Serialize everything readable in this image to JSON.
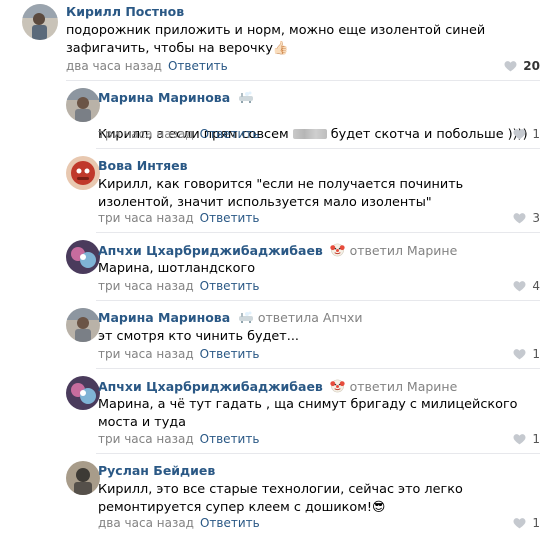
{
  "comments": [
    {
      "author": "Кирилл Постнов",
      "reply_to": "",
      "text": "подорожник приложить и норм, можно еще изолентой синей зафигачить, чтобы на верочку👍🏻",
      "time": "два часа назад",
      "reply_label": "Ответить",
      "likes": "20",
      "avatar_colors": [
        "#5b6a7a",
        "#c9c3b8"
      ]
    },
    {
      "author": "Марина Маринова",
      "reply_to": "",
      "text_before": "Кирилл, а если прям совсем ",
      "text_after": " будет скотча и побольше ))))",
      "time": "три часа назад",
      "reply_label": "Ответить",
      "likes": "1",
      "avatar_colors": [
        "#7a7f86",
        "#b9b2a8"
      ]
    },
    {
      "author": "Вова Интяев",
      "reply_to": "",
      "text": "Кирилл, как говорится \"если не получается починить изолентой, значит используется мало изоленты\"",
      "time": "три часа назад",
      "reply_label": "Ответить",
      "likes": "3",
      "avatar_colors": [
        "#c0392b",
        "#e8c8b0"
      ]
    },
    {
      "author": "Апчхи Цхарбриджибаджибаев",
      "reply_to": "ответил Марине",
      "text": "Марина, шотландского",
      "time": "три часа назад",
      "reply_label": "Ответить",
      "likes": "4",
      "avatar_colors": [
        "#4a3b5c",
        "#c76c9e"
      ]
    },
    {
      "author": "Марина Маринова",
      "reply_to": "ответила Апчхи",
      "text": "эт смотря кто чинить будет...",
      "time": "три часа назад",
      "reply_label": "Ответить",
      "likes": "1",
      "avatar_colors": [
        "#7a7f86",
        "#b9b2a8"
      ]
    },
    {
      "author": "Апчхи Цхарбриджибаджибаев",
      "reply_to": "ответил Марине",
      "text": "Марина, а чё тут гадать , ща снимут бригаду с милицейского моста и туда",
      "time": "три часа назад",
      "reply_label": "Ответить",
      "likes": "1",
      "avatar_colors": [
        "#4a3b5c",
        "#c76c9e"
      ]
    },
    {
      "author": "Руслан Бейдиев",
      "reply_to": "",
      "text": "Кирилл, это все старые технологии, сейчас это легко ремонтируется супер клеем с дошиком!😎",
      "time": "два часа назад",
      "reply_label": "Ответить",
      "likes": "1",
      "avatar_colors": [
        "#3d3a35",
        "#a89c8a"
      ]
    }
  ],
  "icons": {
    "heart": "heart-icon",
    "bath_emoji": "bathtub-emoji-icon",
    "clown_emoji": "clown-emoji-icon"
  },
  "colors": {
    "link": "#2a5885",
    "meta": "#828282",
    "divider": "#e7e8ec"
  }
}
